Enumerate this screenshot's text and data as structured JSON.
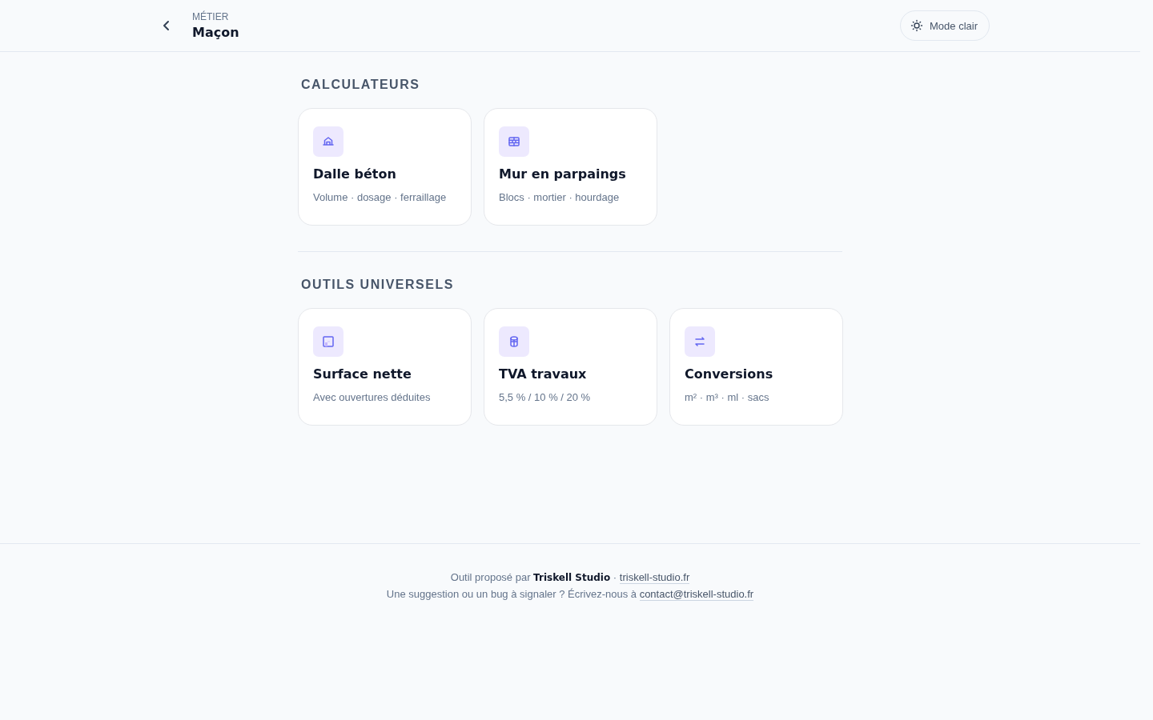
{
  "header": {
    "eyebrow": "MÉTIER",
    "title": "Maçon",
    "theme_button": {
      "label": "Mode clair"
    }
  },
  "sections": [
    {
      "title": "CALCULATEURS",
      "cards": [
        {
          "kind": "house",
          "title": "Dalle béton",
          "subtitle": "Volume · dosage · ferraillage"
        },
        {
          "kind": "bricks",
          "title": "Mur en parpaings",
          "subtitle": "Blocs · mortier · hourdage"
        }
      ]
    },
    {
      "title": "OUTILS UNIVERSELS",
      "cards": [
        {
          "kind": "square",
          "title": "Surface nette",
          "subtitle": "Avec ouvertures déduites"
        },
        {
          "kind": "cylinder",
          "title": "TVA travaux",
          "subtitle": "5,5 % / 10 % / 20 %"
        },
        {
          "kind": "swap",
          "title": "Conversions",
          "subtitle": "m² · m³ · ml · sacs"
        }
      ]
    }
  ],
  "footer": {
    "lines": [
      {
        "text": "Outil proposé par **Triskell Studio** ·",
        "link": "triskell-studio.fr"
      },
      {
        "text": "Une suggestion ou un bug à signaler ? Écrivez-nous à",
        "link": "contact@triskell-studio.fr"
      }
    ]
  }
}
